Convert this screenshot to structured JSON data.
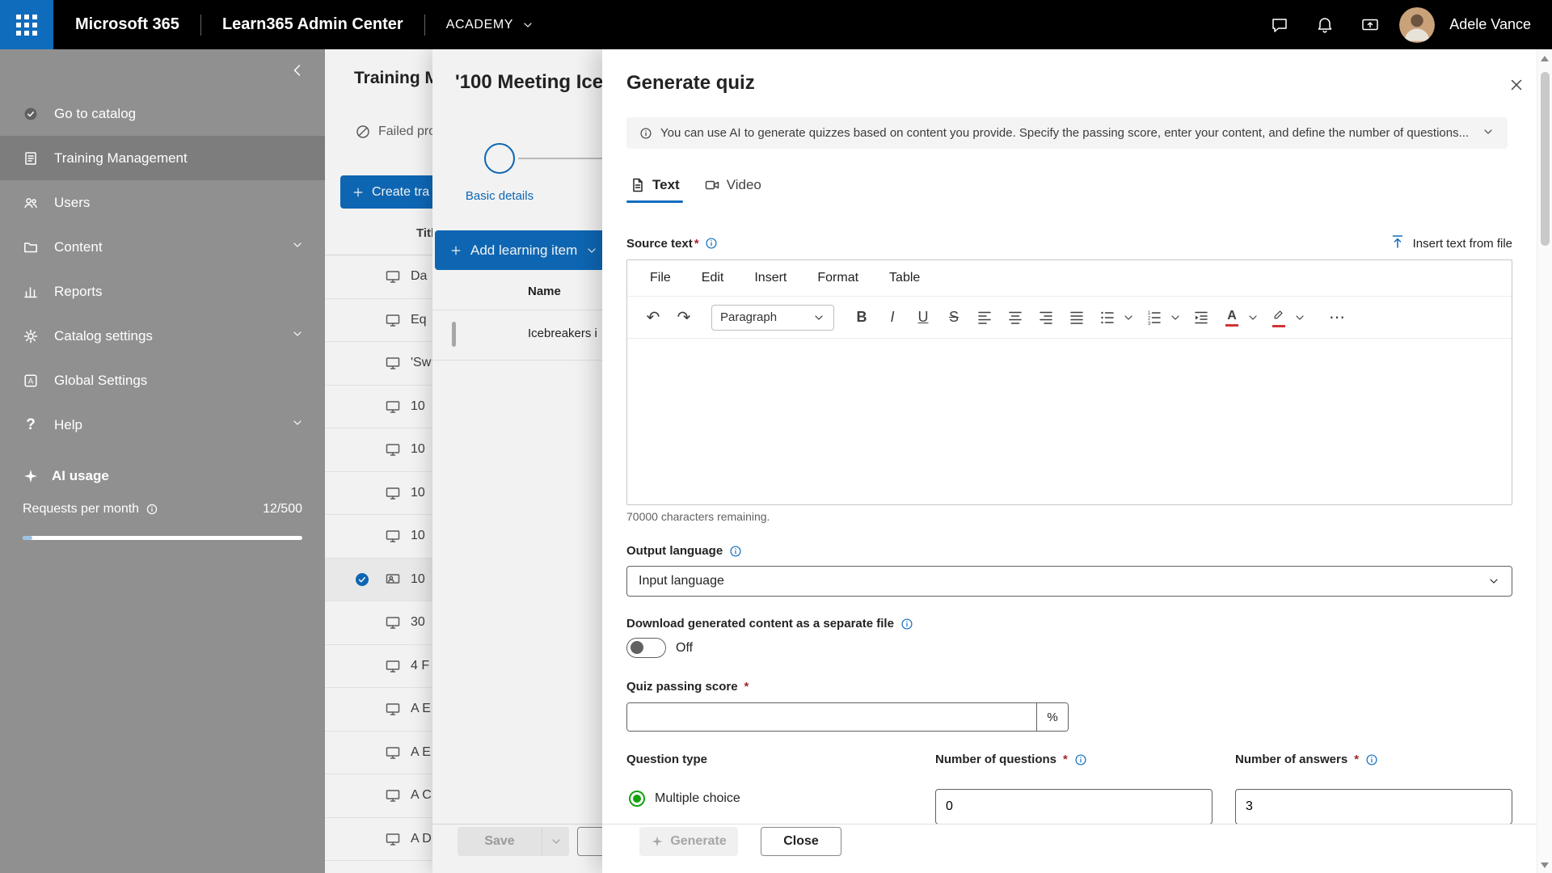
{
  "topbar": {
    "brand": "Microsoft 365",
    "app_title": "Learn365 Admin Center",
    "org_menu": "ACADEMY",
    "user_name": "Adele Vance"
  },
  "sidebar": {
    "items": [
      {
        "label": "Go to catalog"
      },
      {
        "label": "Training Management",
        "selected": true
      },
      {
        "label": "Users"
      },
      {
        "label": "Content",
        "expandable": true
      },
      {
        "label": "Reports"
      },
      {
        "label": "Catalog settings",
        "expandable": true
      },
      {
        "label": "Global Settings"
      },
      {
        "label": "Help",
        "expandable": true
      }
    ],
    "ai_usage_label": "AI usage",
    "requests_label": "Requests per month",
    "requests_value": "12/500"
  },
  "main": {
    "page_title": "Training M",
    "status_text": "Failed pro",
    "create_button": "Create tra",
    "column_header": "Titl",
    "rows": [
      {
        "label": "Da"
      },
      {
        "label": "Eq"
      },
      {
        "label": "'Sw"
      },
      {
        "label": "10"
      },
      {
        "label": "10"
      },
      {
        "label": "10"
      },
      {
        "label": "10"
      },
      {
        "label": "10",
        "selected": true
      },
      {
        "label": "30"
      },
      {
        "label": "4 F"
      },
      {
        "label": "A E"
      },
      {
        "label": "A E"
      },
      {
        "label": "A C"
      },
      {
        "label": "A D"
      }
    ]
  },
  "drawer": {
    "title": "'100 Meeting Ice",
    "step_label": "Basic details",
    "add_button": "Add learning item",
    "name_header": "Name",
    "item_name": "Icebreakers i",
    "save_button": "Save"
  },
  "quiz": {
    "title": "Generate quiz",
    "info_text": "You can use AI to generate quizzes based on content you provide. Specify the passing score, enter your content, and define the number of questions...",
    "tab_text": "Text",
    "tab_video": "Video",
    "source_label": "Source text",
    "required_mark": "*",
    "insert_from_file": "Insert text from file",
    "editor_menu": [
      "File",
      "Edit",
      "Insert",
      "Format",
      "Table"
    ],
    "paragraph_style": "Paragraph",
    "chars_remaining": "70000 characters remaining.",
    "output_language_label": "Output language",
    "output_language_value": "Input language",
    "download_label": "Download generated content as a separate file",
    "toggle_state": "Off",
    "passing_score_label": "Quiz passing score",
    "percent_suffix": "%",
    "question_type_label": "Question type",
    "question_type_option": "Multiple choice",
    "num_questions_label": "Number of questions",
    "num_questions_value": "0",
    "num_answers_label": "Number of answers",
    "num_answers_value": "3",
    "generate_button": "Generate",
    "close_button": "Close"
  },
  "glyphs": {
    "undo": "↶",
    "redo": "↷",
    "bold": "B",
    "italic": "I",
    "underline": "U",
    "strike": "S",
    "more": "⋯",
    "help": "?"
  },
  "colors": {
    "accent": "#0f6cbd",
    "topbar": "#000000",
    "sidebar": "#909090",
    "sidebar_selected": "#7d7d7d",
    "radio_green": "#13a10e"
  }
}
